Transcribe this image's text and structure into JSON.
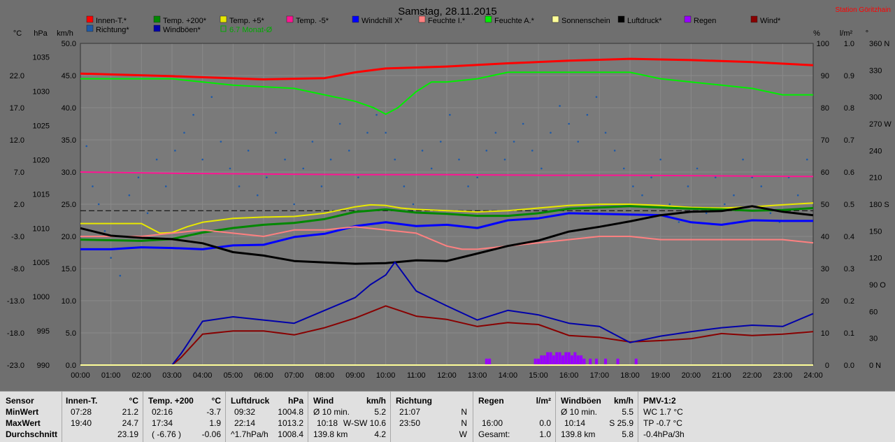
{
  "chart_data": {
    "type": "line",
    "title": "Samstag, 28.11.2015",
    "station": "Station Göritzhain",
    "x_ticks": [
      "00:00",
      "01:00",
      "02:00",
      "03:00",
      "04:00",
      "05:00",
      "06:00",
      "07:00",
      "08:00",
      "09:00",
      "10:00",
      "11:00",
      "12:00",
      "13:00",
      "14:00",
      "15:00",
      "16:00",
      "17:00",
      "18:00",
      "19:00",
      "20:00",
      "21:00",
      "22:00",
      "23:00",
      "24:00"
    ],
    "axes": {
      "temp": {
        "label": "°C",
        "ticks": [
          "22.0",
          "17.0",
          "12.0",
          "7.0",
          "2.0",
          "-3.0",
          "-8.0",
          "-13.0",
          "-18.0",
          "-23.0"
        ],
        "range": [
          -23,
          27
        ]
      },
      "pressure": {
        "label": "hPa",
        "ticks": [
          "1035",
          "1030",
          "1025",
          "1020",
          "1015",
          "1010",
          "1005",
          "1000",
          "995",
          "990"
        ],
        "range": [
          990,
          1037
        ]
      },
      "wind": {
        "label": "km/h",
        "ticks": [
          "50.0",
          "45.0",
          "40.0",
          "35.0",
          "30.0",
          "25.0",
          "20.0",
          "15.0",
          "10.0",
          "5.0",
          "0.0"
        ],
        "range": [
          0,
          50
        ]
      },
      "humidity": {
        "label": "%",
        "ticks": [
          "100",
          "90",
          "80",
          "70",
          "60",
          "50",
          "40",
          "30",
          "20",
          "10",
          "0"
        ],
        "range": [
          0,
          100
        ]
      },
      "rain": {
        "label": "l/m²",
        "ticks": [
          "1.0",
          "0.9",
          "0.8",
          "0.7",
          "0.6",
          "0.5",
          "0.4",
          "0.3",
          "0.2",
          "0.1",
          "0.0"
        ],
        "range": [
          0,
          1
        ]
      },
      "direction": {
        "label": "°",
        "ticks": [
          "360 N",
          "330",
          "300",
          "270 W",
          "240",
          "210",
          "180 S",
          "150",
          "120",
          "90 O",
          "60",
          "30",
          "0 N"
        ],
        "range": [
          0,
          360
        ]
      }
    },
    "legend": [
      {
        "name": "Innen-T.*",
        "color": "#ff0000"
      },
      {
        "name": "Temp. +200*",
        "color": "#008800"
      },
      {
        "name": "Temp. +5*",
        "color": "#e8e800"
      },
      {
        "name": "Temp. -5*",
        "color": "#ff1493"
      },
      {
        "name": "Windchill X*",
        "color": "#0000ff"
      },
      {
        "name": "Feuchte I.*",
        "color": "#ff8080"
      },
      {
        "name": "Feuchte A.*",
        "color": "#00ee00"
      },
      {
        "name": "Sonnenschein",
        "color": "#ffff99"
      },
      {
        "name": "Luftdruck*",
        "color": "#000000"
      },
      {
        "name": "Regen",
        "color": "#9900ff"
      },
      {
        "name": "Wind*",
        "color": "#880000"
      },
      {
        "name": "Richtung*",
        "color": "#1e5aa8"
      },
      {
        "name": "Windböen*",
        "color": "#0000aa"
      },
      {
        "name": "6.7 Monat-Ø",
        "color": "#00aa00"
      }
    ],
    "series": [
      {
        "name": "Innen-T.*",
        "axis": "temp",
        "hours": [
          0,
          3,
          6,
          8,
          9,
          10,
          12,
          14,
          16,
          18,
          20,
          22,
          24
        ],
        "values": [
          22.3,
          21.9,
          21.4,
          21.6,
          22.5,
          23.1,
          23.4,
          23.9,
          24.3,
          24.6,
          24.4,
          24.1,
          23.6
        ]
      },
      {
        "name": "Feuchte A.*",
        "axis": "humidity",
        "hours": [
          0,
          2,
          3,
          5,
          7,
          8,
          9,
          9.6,
          10,
          10.4,
          11,
          11.5,
          12,
          13,
          14,
          15,
          16,
          17,
          18,
          19,
          20,
          21,
          22,
          23,
          24
        ],
        "values": [
          89,
          89,
          89,
          87,
          86,
          84,
          82,
          80,
          78,
          80,
          85,
          88,
          88,
          89,
          91,
          91,
          91,
          91,
          91,
          89,
          88,
          87,
          86,
          84,
          84
        ]
      },
      {
        "name": "Temp. -5*",
        "axis": "temp",
        "hours": [
          0,
          3,
          6,
          9,
          12,
          15,
          18,
          21,
          24
        ],
        "values": [
          7.0,
          6.8,
          6.7,
          6.6,
          6.6,
          6.5,
          6.5,
          6.4,
          6.3
        ]
      },
      {
        "name": "Temp. +5*",
        "axis": "temp",
        "hours": [
          0,
          2,
          2.6,
          3,
          3.5,
          4,
          5,
          6,
          7,
          8,
          9,
          9.5,
          10,
          10.5,
          11,
          12,
          13,
          14,
          15,
          16,
          17,
          18,
          19,
          20,
          21,
          22,
          23,
          24
        ],
        "values": [
          -1.0,
          -1.0,
          -2.5,
          -2.4,
          -1.5,
          -0.8,
          -0.2,
          0.0,
          0.1,
          0.6,
          1.6,
          1.9,
          1.8,
          1.4,
          1.2,
          1.0,
          0.8,
          1.0,
          1.4,
          1.8,
          2.0,
          2.0,
          1.8,
          1.5,
          1.4,
          1.6,
          1.9,
          2.2
        ]
      },
      {
        "name": "Temp. +200*",
        "axis": "temp",
        "hours": [
          0,
          2,
          3,
          4,
          5,
          6,
          7,
          8,
          9,
          10,
          11,
          12,
          13,
          14,
          15,
          16,
          17,
          18,
          19,
          20,
          21,
          22,
          23,
          24
        ],
        "values": [
          -3.5,
          -3.7,
          -3.4,
          -2.4,
          -1.7,
          -1.2,
          -0.9,
          -0.3,
          0.8,
          1.2,
          0.7,
          0.5,
          0.2,
          0.2,
          0.6,
          1.3,
          1.5,
          1.7,
          1.5,
          1.3,
          1.2,
          1.0,
          1.1,
          1.4
        ]
      },
      {
        "name": "Windchill X*",
        "axis": "temp",
        "hours": [
          0,
          1,
          2,
          3,
          4,
          5,
          6,
          7,
          8,
          9,
          10,
          11,
          12,
          13,
          14,
          15,
          16,
          17,
          18,
          19,
          20,
          21,
          22,
          23,
          24
        ],
        "values": [
          -5.0,
          -5.0,
          -4.7,
          -4.8,
          -5.0,
          -4.4,
          -4.3,
          -3.1,
          -2.6,
          -1.4,
          -0.8,
          -1.4,
          -1.2,
          -1.7,
          -0.5,
          -0.2,
          0.6,
          0.5,
          0.4,
          0.3,
          -0.8,
          -1.2,
          -0.5,
          -0.6,
          -0.6
        ]
      },
      {
        "name": "Feuchte I.*",
        "axis": "humidity",
        "hours": [
          0,
          2,
          3,
          4,
          5,
          6,
          7,
          8,
          9,
          10,
          11,
          12,
          12.5,
          13,
          14,
          15,
          16,
          17,
          18,
          19,
          20,
          21,
          22,
          23,
          24
        ],
        "values": [
          40,
          40,
          41,
          42,
          41,
          40,
          42,
          42,
          43,
          42,
          41,
          37,
          36,
          36,
          37,
          38,
          39,
          40,
          40,
          39,
          39,
          39,
          39,
          39,
          38
        ]
      },
      {
        "name": "Luftdruck*",
        "axis": "pressure",
        "hours": [
          0,
          1,
          2,
          3,
          4,
          5,
          6,
          7,
          8,
          9,
          10,
          11,
          12,
          13,
          14,
          15,
          16,
          17,
          18,
          19,
          20,
          21,
          22,
          23,
          24
        ],
        "values": [
          1010.0,
          1008.9,
          1008.6,
          1008.4,
          1007.8,
          1006.5,
          1006.0,
          1005.2,
          1005.0,
          1004.8,
          1004.9,
          1005.3,
          1005.2,
          1006.3,
          1007.4,
          1008.2,
          1009.5,
          1010.2,
          1011.0,
          1011.9,
          1012.4,
          1012.5,
          1013.2,
          1012.4,
          1011.9
        ]
      },
      {
        "name": "Wind*",
        "axis": "wind",
        "hours": [
          0,
          1,
          2,
          3,
          3.3,
          4,
          5,
          6,
          7,
          8,
          9,
          10,
          10.5,
          11,
          12,
          13,
          14,
          15,
          16,
          17,
          18,
          19,
          20,
          21,
          22,
          23,
          24
        ],
        "values": [
          0,
          0,
          0,
          0,
          1.2,
          4.8,
          5.3,
          5.3,
          4.7,
          5.8,
          7.3,
          9.2,
          8.4,
          7.6,
          7.1,
          6.0,
          6.6,
          6.3,
          4.6,
          4.3,
          3.6,
          3.8,
          4.1,
          4.9,
          4.6,
          4.8,
          5.2
        ]
      },
      {
        "name": "Windböen*",
        "axis": "wind",
        "hours": [
          0,
          1,
          2,
          3,
          3.3,
          4,
          5,
          6,
          7,
          8,
          9,
          9.5,
          10,
          10.3,
          11,
          12,
          13,
          14,
          15,
          16,
          17,
          18,
          19,
          20,
          21,
          22,
          23,
          24
        ],
        "values": [
          0,
          0,
          0,
          0,
          1.8,
          6.8,
          7.5,
          7.0,
          6.5,
          8.5,
          10.5,
          12.5,
          14.0,
          16.0,
          11.5,
          9.2,
          7.0,
          8.5,
          7.8,
          6.5,
          6.0,
          3.5,
          4.5,
          5.2,
          5.8,
          6.2,
          6.0,
          8.0
        ]
      },
      {
        "name": "Sonnenschein",
        "axis": "rain",
        "hours": [
          0,
          24
        ],
        "values": [
          0,
          0
        ]
      }
    ],
    "rain_events_hours": [
      13.3,
      13.4,
      14.9,
      15.0,
      15.1,
      15.2,
      15.3,
      15.4,
      15.5,
      15.6,
      15.7,
      15.8,
      15.9,
      16.0,
      16.1,
      16.2,
      16.3,
      16.4,
      16.5,
      16.7,
      16.9,
      17.2,
      17.6,
      18.2
    ],
    "rain_event_values": [
      0.02,
      0.02,
      0.02,
      0.02,
      0.03,
      0.03,
      0.04,
      0.04,
      0.03,
      0.04,
      0.04,
      0.03,
      0.04,
      0.04,
      0.03,
      0.04,
      0.03,
      0.03,
      0.02,
      0.02,
      0.02,
      0.02,
      0.02,
      0.02
    ],
    "dashed_reference": {
      "name": "6.7 Monat-Ø",
      "axis": "temp",
      "value": 1.0
    },
    "direction_scatter": {
      "axis": "direction",
      "hours": [
        0.2,
        0.4,
        0.6,
        0.8,
        1.0,
        1.3,
        1.6,
        1.9,
        2.2,
        2.5,
        2.8,
        3.1,
        3.4,
        3.7,
        4.0,
        4.3,
        4.6,
        4.9,
        5.2,
        5.5,
        5.8,
        6.1,
        6.4,
        6.7,
        7.0,
        7.3,
        7.6,
        7.9,
        8.2,
        8.5,
        8.8,
        9.1,
        9.4,
        9.7,
        10.0,
        10.3,
        10.6,
        10.9,
        11.2,
        11.5,
        11.8,
        12.1,
        12.4,
        12.7,
        13.0,
        13.3,
        13.6,
        13.9,
        14.2,
        14.5,
        14.8,
        15.1,
        15.4,
        15.7,
        16.0,
        16.3,
        16.6,
        16.9,
        17.2,
        17.5,
        17.8,
        18.1,
        18.4,
        18.7,
        19.0,
        19.3,
        19.6,
        19.9,
        20.2,
        20.5,
        20.8,
        21.1,
        21.4,
        21.7,
        22.0,
        22.3,
        22.6,
        22.9,
        23.2,
        23.5,
        23.8
      ],
      "values": [
        245,
        200,
        180,
        150,
        120,
        100,
        190,
        210,
        170,
        230,
        200,
        240,
        260,
        280,
        230,
        300,
        250,
        220,
        200,
        240,
        190,
        210,
        260,
        230,
        180,
        220,
        250,
        200,
        230,
        270,
        240,
        210,
        260,
        280,
        260,
        230,
        200,
        180,
        240,
        220,
        250,
        280,
        230,
        200,
        210,
        240,
        260,
        230,
        250,
        270,
        240,
        220,
        260,
        290,
        270,
        250,
        280,
        300,
        260,
        240,
        220,
        200,
        190,
        210,
        230,
        180,
        160,
        200,
        220,
        170,
        210,
        180,
        190,
        230,
        210,
        200,
        170,
        160,
        210,
        190,
        230
      ]
    }
  },
  "stats": {
    "sensor": {
      "header": "Sensor",
      "rows": [
        "MinWert",
        "MaxWert",
        "Durchschnitt"
      ]
    },
    "innen": {
      "header": "Innen-T.",
      "unit": "°C",
      "c1": [
        "07:28",
        "19:40",
        ""
      ],
      "c2": [
        "21.2",
        "24.7",
        "23.19"
      ]
    },
    "temp200": {
      "header": "Temp. +200",
      "unit": "°C",
      "c1": [
        "02:16",
        "17:34",
        "( -6.76 )"
      ],
      "c2": [
        "-3.7",
        "1.9",
        "-0.06"
      ]
    },
    "luftdruck": {
      "header": "Luftdruck",
      "unit": "hPa",
      "c1": [
        "09:32",
        "22:14",
        "^1.7hPa/h"
      ],
      "c2": [
        "1004.8",
        "1013.2",
        "1008.4"
      ]
    },
    "wind": {
      "header": "Wind",
      "unit": "km/h",
      "c1": [
        "Ø 10 min.",
        "10:18",
        "139.8 km"
      ],
      "c2": [
        "5.2",
        "W-SW 10.6",
        "4.2"
      ]
    },
    "richtung": {
      "header": "Richtung",
      "c1": [
        "21:07",
        "23:50",
        ""
      ],
      "c2": [
        "N",
        "N",
        "W"
      ]
    },
    "regen": {
      "header": "Regen",
      "unit": "l/m²",
      "c1": [
        "",
        "16:00",
        "Gesamt:"
      ],
      "c2": [
        "",
        "0.0",
        "1.0"
      ]
    },
    "windboen": {
      "header": "Windböen",
      "unit": "km/h",
      "c1": [
        "Ø 10 min.",
        "10:14",
        "139.8 km"
      ],
      "c2": [
        "5.5",
        "S 25.9",
        "5.8"
      ]
    },
    "pmv": {
      "header": "PMV-1:2",
      "c1": [
        "WC 1.7 °C",
        "TP -0.7 °C",
        "-0.4hPa/3h"
      ]
    }
  }
}
